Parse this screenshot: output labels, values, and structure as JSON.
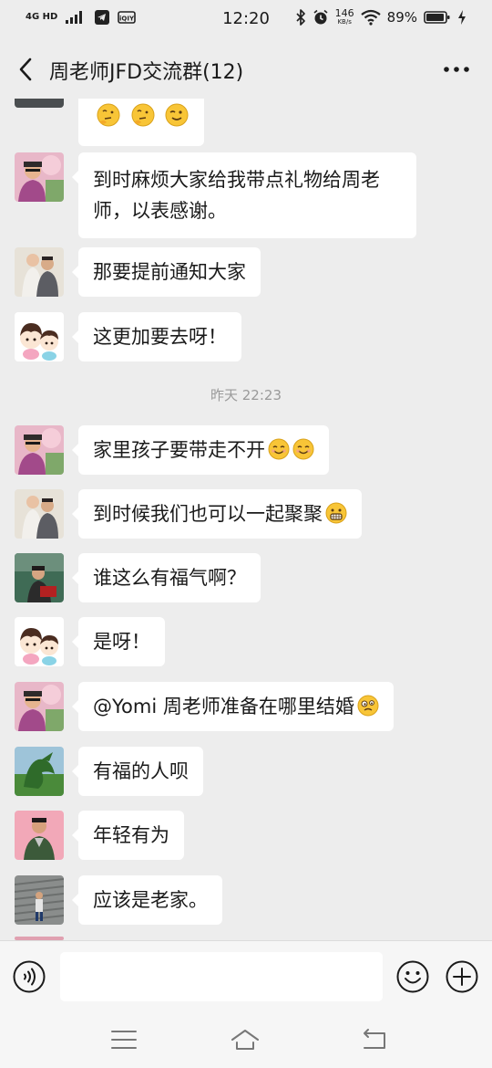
{
  "status_bar": {
    "network": "4G HD",
    "time": "12:20",
    "speed_value": "146",
    "speed_unit": "KB/s",
    "battery": "89%"
  },
  "header": {
    "title": "周老师JFD交流群(12)"
  },
  "messages": [
    {
      "text": "",
      "emojis": [
        "thinking-face",
        "thinking-face",
        "winking-face"
      ],
      "partial": true
    },
    {
      "text": "到时麻烦大家给我带点礼物给周老师，以表感谢。",
      "emojis": []
    },
    {
      "text": "那要提前通知大家",
      "emojis": []
    },
    {
      "text": "这更加要去呀！",
      "emojis": []
    },
    {
      "text": "家里孩子要带走不开",
      "emojis": [
        "smiling-face",
        "smiling-face"
      ]
    },
    {
      "text": "到时候我们也可以一起聚聚",
      "emojis": [
        "grimacing-face"
      ]
    },
    {
      "text": "谁这么有福气啊？",
      "emojis": []
    },
    {
      "text": "是呀！",
      "emojis": []
    },
    {
      "text": "@Yomi 周老师准备在哪里结婚",
      "emojis": [
        "woozy-face"
      ]
    },
    {
      "text": "有福的人呗",
      "emojis": []
    },
    {
      "text": "年轻有为",
      "emojis": []
    },
    {
      "text": "应该是老家。",
      "emojis": []
    }
  ],
  "timestamp": "昨天 22:23",
  "input": {
    "placeholder": ""
  },
  "colors": {
    "background": "#ededed",
    "bubble": "#ffffff",
    "timestamp_text": "#9a9a9a"
  }
}
